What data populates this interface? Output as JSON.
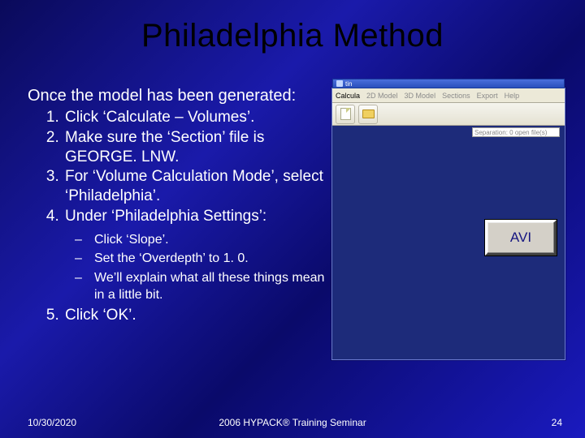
{
  "title": "Philadelphia Method",
  "intro": "Once the model has been generated:",
  "steps": [
    "Click ‘Calculate – Volumes’.",
    "Make sure the ‘Section’ file is GEORGE. LNW.",
    "For ‘Volume Calculation Mode’, select ‘Philadelphia’.",
    "Under ‘Philadelphia Settings’:"
  ],
  "substeps": [
    "Click ‘Slope’.",
    "Set the ‘Overdepth’ to 1. 0.",
    "We’ll explain what all these things mean in a little bit."
  ],
  "step5": "Click ‘OK’.",
  "panel": {
    "titlebar": "tin",
    "menu": [
      "Calcula",
      "2D Model",
      "3D Model",
      "Sections",
      "Export",
      "Help"
    ],
    "smallbox": "Separation: 0 open file(s)"
  },
  "avi_label": "AVI",
  "footer": {
    "date": "10/30/2020",
    "center": "2006 HYPACK® Training Seminar",
    "page": "24"
  }
}
